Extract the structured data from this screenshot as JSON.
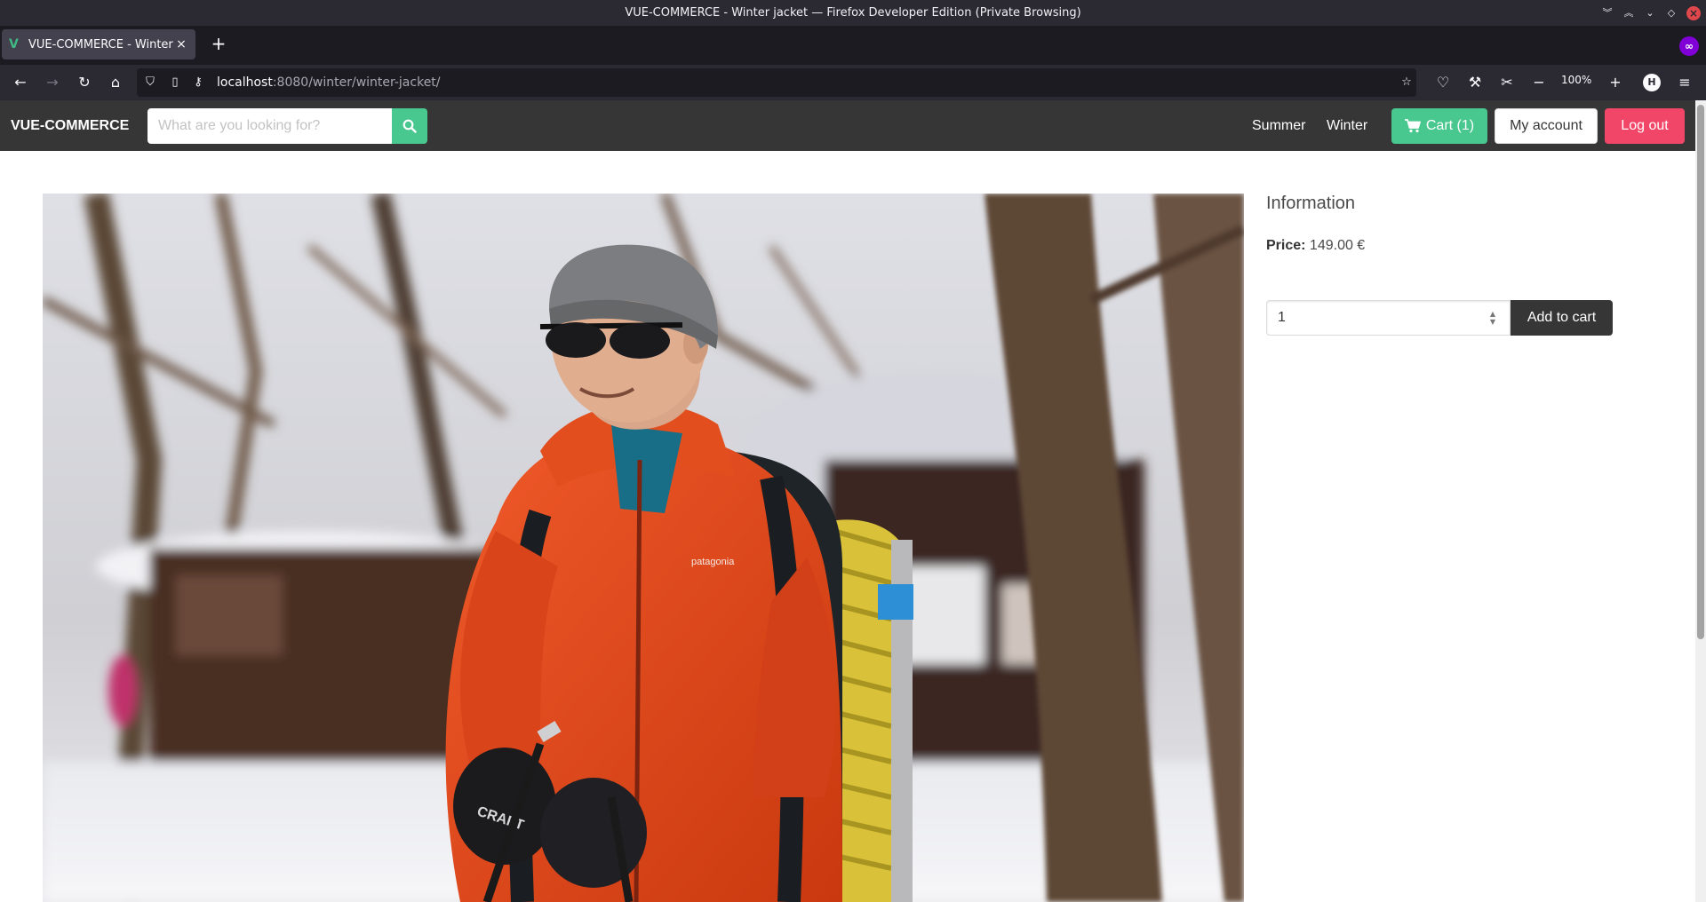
{
  "window": {
    "title": "VUE-COMMERCE - Winter jacket — Firefox Developer Edition (Private Browsing)"
  },
  "browser": {
    "tab": {
      "title": "VUE-COMMERCE - Winter jacket",
      "close": "×"
    },
    "new_tab": "+",
    "url_host": "localhost",
    "url_path": ":8080/winter/winter-jacket/",
    "zoom": "100%",
    "profile_initial": "H"
  },
  "header": {
    "brand": "VUE-COMMERCE",
    "search_placeholder": "What are you looking for?",
    "nav": {
      "summer": "Summer",
      "winter": "Winter"
    },
    "cart_label": "Cart (1)",
    "account_label": "My account",
    "logout_label": "Log out"
  },
  "product": {
    "info_title": "Information",
    "price_label": "Price:",
    "price_value": "149.00 €",
    "quantity": "1",
    "add_to_cart_label": "Add to cart",
    "image_text": {
      "jacket_brand": "patagonia",
      "glove_brand": "CRAFT"
    }
  },
  "colors": {
    "header_bg": "#363636",
    "success": "#48c78e",
    "danger": "#f14668",
    "jacket": "#e5461c"
  }
}
